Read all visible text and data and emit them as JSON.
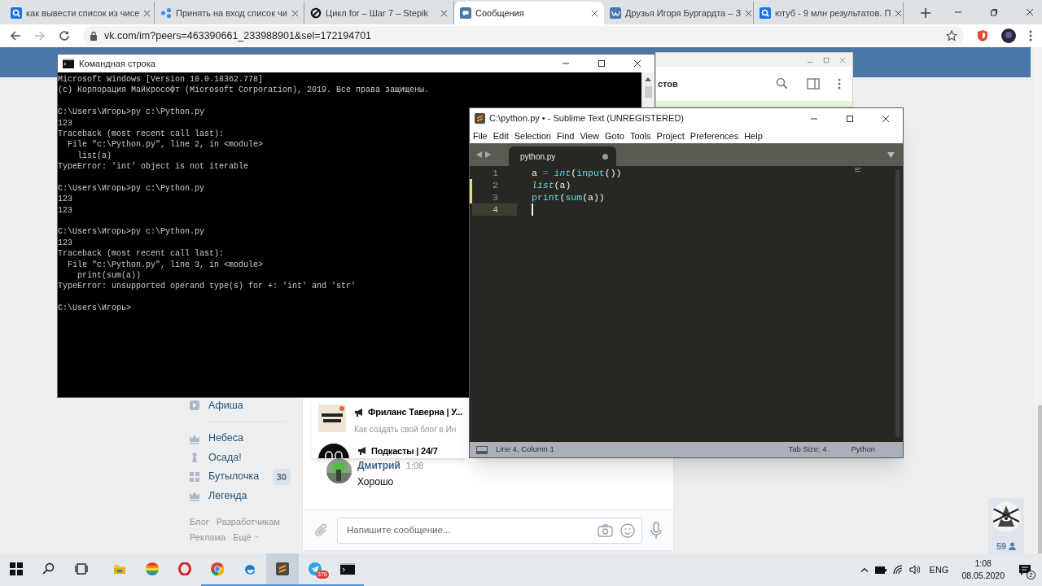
{
  "browser": {
    "tabs": [
      {
        "title": "как вывести список из чисе",
        "kind": "search",
        "selected": false
      },
      {
        "title": "Принять на вход список чи",
        "kind": "nodes",
        "selected": false
      },
      {
        "title": "Цикл for – Шаг 7 – Stepik",
        "kind": "ring",
        "selected": false
      },
      {
        "title": "Сообщения",
        "kind": "chat",
        "selected": true
      },
      {
        "title": "Друзья Игоря Бургардта – З",
        "kind": "vk",
        "selected": false
      },
      {
        "title": "ютуб - 9 млн результатов. П",
        "kind": "search",
        "selected": false
      }
    ],
    "url": "vk.com/im?peers=463390661_233988901&sel=172194701"
  },
  "back_window": {
    "text": "стов"
  },
  "cmd": {
    "title": "Командная строка",
    "blocks": [
      [
        "Microsoft Windows [Version 10.0.18362.778]",
        "(c) Корпорация Майкрософт (Microsoft Corporation), 2019. Все права защищены."
      ],
      [
        "C:\\Users\\Игорь>py c:\\Python.py",
        "123",
        "Traceback (most recent call last):",
        "  File \"c:\\Python.py\", line 2, in <module>",
        "    list(a)",
        "TypeError: 'int' object is not iterable"
      ],
      [
        "C:\\Users\\Игорь>py c:\\Python.py",
        "123",
        "123"
      ],
      [
        "C:\\Users\\Игорь>py c:\\Python.py",
        "123",
        "Traceback (most recent call last):",
        "  File \"c:\\Python.py\", line 3, in <module>",
        "    print(sum(a))",
        "TypeError: unsupported operand type(s) for +: 'int' and 'str'"
      ],
      [
        "C:\\Users\\Игорь>"
      ]
    ]
  },
  "sublime": {
    "title": "C:\\python.py • - Sublime Text (UNREGISTERED)",
    "menu": [
      "File",
      "Edit",
      "Selection",
      "Find",
      "View",
      "Goto",
      "Tools",
      "Project",
      "Preferences",
      "Help"
    ],
    "tab": {
      "name": "python.py",
      "dirty": true
    },
    "lines": [
      {
        "number": "1",
        "modified": false,
        "current": false,
        "tokens": [
          {
            "text": "a ",
            "kind": "plain"
          },
          {
            "text": "=",
            "kind": "op"
          },
          {
            "text": " int",
            "kind": "builtin"
          },
          {
            "text": "(",
            "kind": "plain"
          },
          {
            "text": "input",
            "kind": "func"
          },
          {
            "text": "())",
            "kind": "plain"
          }
        ]
      },
      {
        "number": "2",
        "modified": true,
        "current": false,
        "tokens": [
          {
            "text": "list",
            "kind": "builtin"
          },
          {
            "text": "(a)",
            "kind": "plain"
          }
        ]
      },
      {
        "number": "3",
        "modified": true,
        "current": false,
        "tokens": [
          {
            "text": "print",
            "kind": "func"
          },
          {
            "text": "(",
            "kind": "plain"
          },
          {
            "text": "sum",
            "kind": "func"
          },
          {
            "text": "(a))",
            "kind": "plain"
          }
        ]
      },
      {
        "number": "4",
        "modified": false,
        "current": true
      }
    ],
    "status": {
      "position": "Line 4, Column 1",
      "tab_size": "Tab Size: 4",
      "syntax": "Python"
    }
  },
  "vk": {
    "sidebar": [
      [
        {
          "label": "Афиша",
          "kind": "play"
        }
      ],
      [
        {
          "label": "Небеса",
          "kind": "crown"
        },
        {
          "label": "Осада!",
          "kind": "pawn"
        },
        {
          "label": "Бутылочка",
          "kind": "grid",
          "count": "30"
        },
        {
          "label": "Легенда",
          "kind": "crown"
        }
      ]
    ],
    "footer": {
      "rows": [
        [
          "Блог",
          "Разработчикам"
        ],
        [
          "Реклама"
        ]
      ],
      "more": "Ещё"
    },
    "dropdown": [
      {
        "title": "Фриланс Таверна | У...",
        "subtitle": "Как создать свой блог в Ин",
        "kind": "square"
      },
      {
        "title": "Подкасты | 24/7",
        "kind": "circle"
      }
    ],
    "message": {
      "author": "Дмитрий",
      "time": "1:08",
      "text": "Хорошо"
    },
    "composer": {
      "placeholder": "Напишите сообщение..."
    },
    "online": {
      "count": "59"
    }
  },
  "taskbar": {
    "items": [
      {
        "kind": "start",
        "running": false,
        "selected": false
      },
      {
        "kind": "search",
        "running": false,
        "selected": false
      },
      {
        "kind": "taskview",
        "running": false,
        "selected": false
      },
      {
        "kind": "folder",
        "running": false,
        "selected": false
      },
      {
        "kind": "rainbow",
        "running": false,
        "selected": false
      },
      {
        "kind": "ring",
        "running": false,
        "selected": false
      },
      {
        "kind": "chrome",
        "running": true,
        "selected": false
      },
      {
        "kind": "swirl",
        "running": true,
        "selected": false
      },
      {
        "kind": "editor",
        "running": true,
        "selected": true
      },
      {
        "kind": "plane",
        "running": true,
        "selected": false,
        "badge": "376"
      },
      {
        "kind": "terminal",
        "running": true,
        "selected": false
      }
    ],
    "lang": "ENG",
    "time": "1:08",
    "date": "08.05.2020",
    "notifications": "2"
  }
}
